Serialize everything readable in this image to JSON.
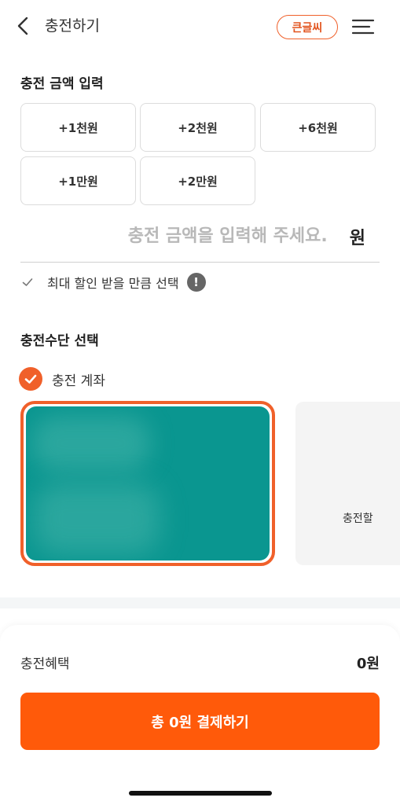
{
  "header": {
    "title": "충전하기",
    "bigtext_label": "큰글씨"
  },
  "amount_section": {
    "title": "충전 금액 입력",
    "quick_amounts": [
      "+1천원",
      "+2천원",
      "+6천원",
      "+1만원",
      "+2만원"
    ],
    "input_placeholder": "충전 금액을 입력해 주세요.",
    "input_value": "",
    "unit": "원",
    "max_discount_label": "최대 할인 받을 만큼 선택"
  },
  "payment_section": {
    "title": "충전수단 선택",
    "account_label": "충전 계좌",
    "add_card_label": "충전할"
  },
  "footer": {
    "benefit_label": "충전혜택",
    "benefit_value": "0원",
    "pay_button_label": "총 0원 결제하기"
  },
  "colors": {
    "accent": "#ff5a0a",
    "card": "#0a9690"
  }
}
